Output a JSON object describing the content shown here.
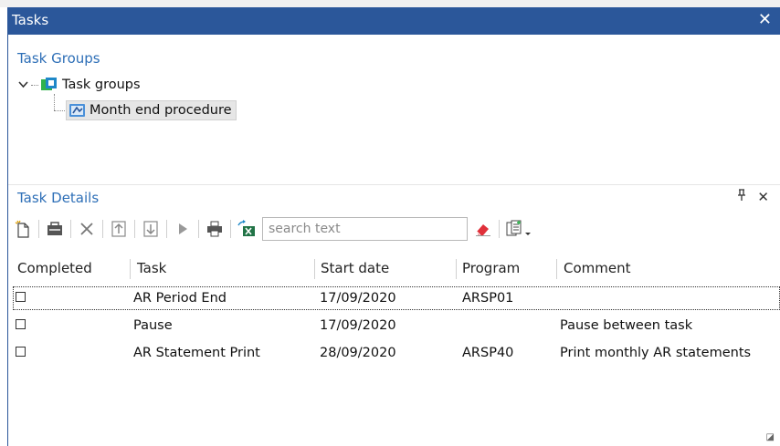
{
  "window": {
    "title": "Tasks",
    "close_glyph": "✕"
  },
  "task_groups": {
    "section_title": "Task Groups",
    "root": {
      "label": "Task groups",
      "expander": "chevron-down",
      "icon": "task-groups-icon"
    },
    "children": [
      {
        "label": "Month end procedure",
        "icon": "task-group-item-icon",
        "selected": true
      }
    ]
  },
  "task_details": {
    "section_title": "Task Details",
    "pane_controls": {
      "pin": "pin-icon",
      "close": "close-icon"
    },
    "toolbar": {
      "search_placeholder": "search text",
      "buttons": [
        "new-task-icon",
        "properties-icon",
        "delete-icon",
        "move-up-icon",
        "move-down-icon",
        "run-icon",
        "print-icon",
        "export-excel-icon",
        "clear-search-icon",
        "column-chooser-icon"
      ]
    },
    "columns": [
      "Completed",
      "Task",
      "Start date",
      "Program",
      "Comment"
    ],
    "rows": [
      {
        "completed": false,
        "task": "AR Period End",
        "start_date": "17/09/2020",
        "program": "ARSP01",
        "comment": ""
      },
      {
        "completed": false,
        "task": "Pause",
        "start_date": "17/09/2020",
        "program": "",
        "comment": "Pause between task"
      },
      {
        "completed": false,
        "task": "AR Statement Print",
        "start_date": "28/09/2020",
        "program": "ARSP40",
        "comment": "Print monthly AR statements"
      }
    ]
  },
  "colors": {
    "titlebar": "#2b579a",
    "section_title": "#2e6fb7",
    "selection": "#e6e6e6"
  }
}
